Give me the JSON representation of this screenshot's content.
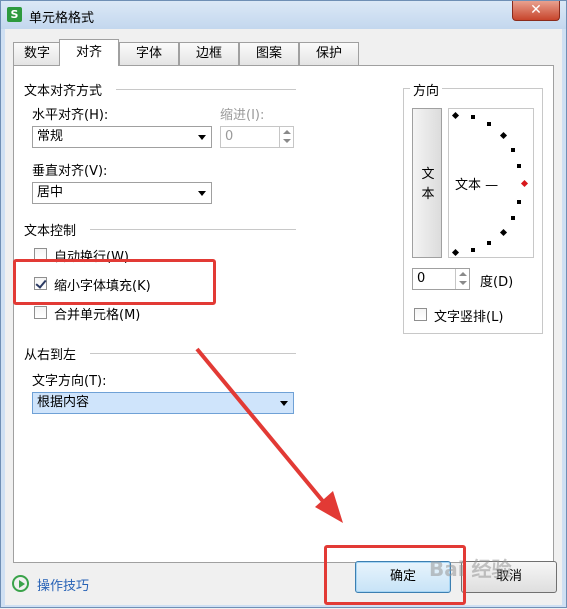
{
  "window": {
    "title": "单元格格式",
    "app_icon_letter": "S",
    "close_symbol": "✕"
  },
  "tabs": [
    {
      "label": "数字",
      "active": false
    },
    {
      "label": "对齐",
      "active": true
    },
    {
      "label": "字体",
      "active": false
    },
    {
      "label": "边框",
      "active": false
    },
    {
      "label": "图案",
      "active": false
    },
    {
      "label": "保护",
      "active": false
    }
  ],
  "text_alignment": {
    "section_title": "文本对齐方式",
    "horizontal_label": "水平对齐(H):",
    "horizontal_value": "常规",
    "indent_label": "缩进(I):",
    "indent_value": "0",
    "vertical_label": "垂直对齐(V):",
    "vertical_value": "居中"
  },
  "text_control": {
    "section_title": "文本控制",
    "wrap_text": {
      "label": "自动换行(W)",
      "checked": false
    },
    "shrink_to_fit": {
      "label": "缩小字体填充(K)",
      "checked": true
    },
    "merge_cells": {
      "label": "合并单元格(M)",
      "checked": false
    }
  },
  "rtl": {
    "section_title": "从右到左",
    "direction_label": "文字方向(T):",
    "direction_value": "根据内容"
  },
  "orientation": {
    "section_title": "方向",
    "vertical_text_button": "文本",
    "dial_text": "文本 —",
    "degrees_value": "0",
    "degrees_label": "度(D)",
    "vertical_stack": {
      "label": "文字竖排(L)",
      "checked": false
    }
  },
  "footer": {
    "help_link": "操作技巧",
    "ok_label": "确定",
    "cancel_label": "取消"
  },
  "overlay": {
    "watermark": "Bai 经验"
  },
  "colors": {
    "annotation_red": "#e23a35",
    "help_green": "#3aa34a",
    "link_blue": "#2762b6"
  }
}
